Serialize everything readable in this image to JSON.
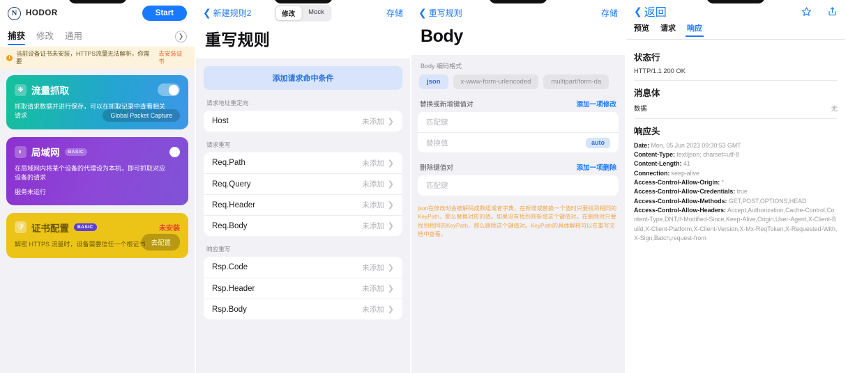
{
  "panel1": {
    "brand": {
      "mark": "N",
      "name": "HODOR"
    },
    "start_label": "Start",
    "tabs": [
      {
        "label": "捕获",
        "active": true
      },
      {
        "label": "修改",
        "active": false
      },
      {
        "label": "通用",
        "active": false
      }
    ],
    "more_icon": "chevron-right-icon",
    "warning": {
      "icon": "warning-icon",
      "text": "当前设备证书未安装，HTTPS流量无法解析，你需要",
      "link": "去安装证书"
    },
    "cards": [
      {
        "icon": "packet-icon",
        "title": "流量抓取",
        "badge": "",
        "desc": "抓取请求数据并进行保存，可以在抓取记录中查看相关请求",
        "sub": "",
        "toggle": "on",
        "button": "Global Packet Capture",
        "status": ""
      },
      {
        "icon": "wifi-icon",
        "title": "局域网",
        "badge": "BASIC",
        "desc": "在局域网内将某个设备的代理设为本机，即可抓取对应设备的请求",
        "sub": "服务未运行",
        "toggle": "off",
        "button": "",
        "status": ""
      },
      {
        "icon": "shield-icon",
        "title": "证书配置",
        "badge": "BASIC",
        "desc": "解密 HTTPS 流量时，设备需要信任一个根证书",
        "sub": "",
        "toggle": "",
        "button": "去配置",
        "status": "未安装"
      }
    ]
  },
  "panel2": {
    "nav": {
      "back_label": "新建规则2",
      "save_label": "存储",
      "segments": [
        {
          "label": "修改",
          "active": true
        },
        {
          "label": "Mock",
          "active": false
        }
      ]
    },
    "title": "重写规则",
    "add_condition": "添加请求命中条件",
    "sections": [
      {
        "label": "请求地址重定向",
        "rows": [
          {
            "name": "Host",
            "value": "未添加"
          }
        ]
      },
      {
        "label": "请求重写",
        "rows": [
          {
            "name": "Req.Path",
            "value": "未添加"
          },
          {
            "name": "Req.Query",
            "value": "未添加"
          },
          {
            "name": "Req.Header",
            "value": "未添加"
          },
          {
            "name": "Req.Body",
            "value": "未添加"
          }
        ]
      },
      {
        "label": "响应重写",
        "rows": [
          {
            "name": "Rsp.Code",
            "value": "未添加"
          },
          {
            "name": "Rsp.Header",
            "value": "未添加"
          },
          {
            "name": "Rsp.Body",
            "value": "未添加"
          }
        ]
      }
    ]
  },
  "panel3": {
    "nav": {
      "back_label": "重写规则",
      "save_label": "存储"
    },
    "title": "Body",
    "encoding_label": "Body 编码格式",
    "chips": [
      {
        "label": "json",
        "selected": true
      },
      {
        "label": "x-www-form-urlencoded",
        "selected": false
      },
      {
        "label": "multipart/form-da",
        "selected": false
      }
    ],
    "replace_section": {
      "title": "替换或新增键值对",
      "action": "添加一项修改",
      "rows": [
        {
          "placeholder": "匹配键",
          "tag": ""
        },
        {
          "placeholder": "替换值",
          "tag": "auto"
        }
      ]
    },
    "delete_section": {
      "title": "删除键值对",
      "action": "添加一项删除",
      "rows": [
        {
          "placeholder": "匹配键",
          "tag": ""
        }
      ]
    },
    "help_text": "json在修改时会被解码成数组或者字典，在新增或替换一个值时只要找到相同的KeyPath，那么替换对应的值。如果没有找到则新增这个键值对。在删除时只要找到相同的KeyPath，那么删除这个键值对。KeyPath的具体解释可以在重写文档中查看。"
  },
  "panel4": {
    "nav": {
      "back_label": "返回",
      "star_icon": "star-icon",
      "share_icon": "share-icon"
    },
    "tabs": [
      {
        "label": "预览",
        "active": false
      },
      {
        "label": "请求",
        "active": false
      },
      {
        "label": "响应",
        "active": true
      }
    ],
    "status_line": {
      "heading": "状态行",
      "value": "HTTP/1.1 200 OK"
    },
    "message_body": {
      "heading": "消息体",
      "key": "数据",
      "value": "无"
    },
    "response_headers": {
      "heading": "响应头",
      "items": [
        {
          "name": "Date:",
          "value": "Mon, 05 Jun 2023 09:30:53 GMT"
        },
        {
          "name": "Content-Type:",
          "value": "text/json; charset=utf-8"
        },
        {
          "name": "Content-Length:",
          "value": "41"
        },
        {
          "name": "Connection:",
          "value": "keep-alive"
        },
        {
          "name": "Access-Control-Allow-Origin:",
          "value": "*"
        },
        {
          "name": "Access-Control-Allow-Credentials:",
          "value": "true"
        },
        {
          "name": "Access-Control-Allow-Methods:",
          "value": "GET,POST,OPTIONS,HEAD"
        },
        {
          "name": "Access-Control-Allow-Headers:",
          "value": "Accept,Authorization,Cache-Control,Content-Type,DNT,If-Modified-Since,Keep-Alive,Origin,User-Agent,X-Client-Build,X-Client-Platform,X-Client-Version,X-Mx-ReqToken,X-Requested-With,X-Sign,Batch,request-from"
        }
      ]
    }
  }
}
